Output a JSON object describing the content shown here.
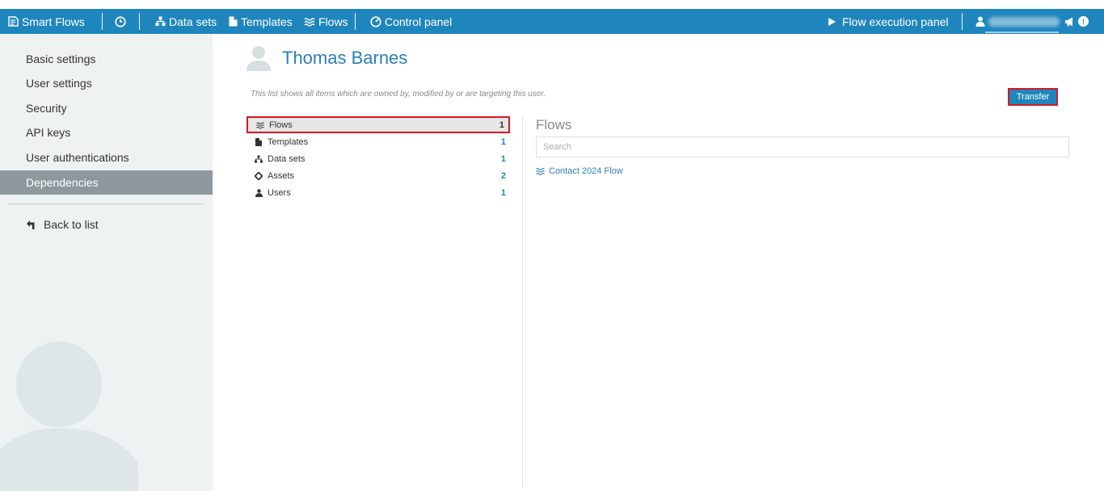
{
  "topbar": {
    "brand": "Smart Flows",
    "nav": {
      "datasets": "Data sets",
      "templates": "Templates",
      "flows": "Flows",
      "control_panel": "Control panel"
    },
    "flow_exec": "Flow execution panel",
    "notif_badge": "!",
    "user_name_hidden": true
  },
  "sidebar": {
    "items": [
      {
        "label": "Basic settings"
      },
      {
        "label": "User settings"
      },
      {
        "label": "Security"
      },
      {
        "label": "API keys"
      },
      {
        "label": "User authentications"
      },
      {
        "label": "Dependencies",
        "active": true
      }
    ],
    "back": "Back to list"
  },
  "user": {
    "name": "Thomas Barnes"
  },
  "description": "This list shows all items which are owned by, modified by or are targeting this user.",
  "transfer_label": "Transfer",
  "dependencies": [
    {
      "icon": "flows-icon",
      "label": "Flows",
      "count": "1",
      "selected": true
    },
    {
      "icon": "file-icon",
      "label": "Templates",
      "count": "1"
    },
    {
      "icon": "sitemap-icon",
      "label": "Data sets",
      "count": "1"
    },
    {
      "icon": "diamond-icon",
      "label": "Assets",
      "count": "2"
    },
    {
      "icon": "user-icon",
      "label": "Users",
      "count": "1"
    }
  ],
  "panel": {
    "title": "Flows",
    "search_placeholder": "Search",
    "results": [
      {
        "icon": "flows-icon",
        "label": "Contact 2024 Flow"
      }
    ]
  },
  "colors": {
    "accent": "#1f86bd",
    "link": "#2a7fb8",
    "highlight": "#d11a26",
    "sidebar_bg": "#eef2f2",
    "sidebar_active": "#8e979c"
  }
}
